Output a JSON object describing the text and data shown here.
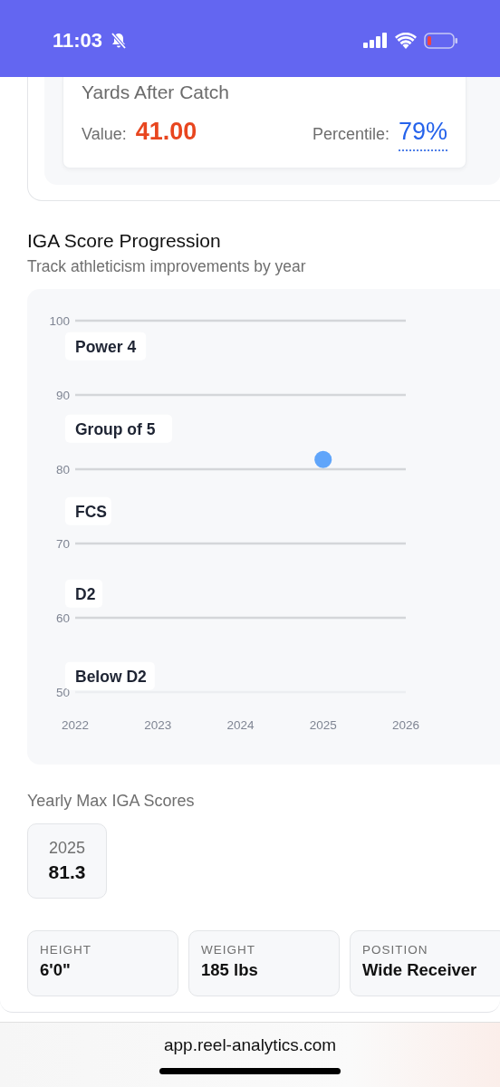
{
  "status_bar": {
    "time": "11:03"
  },
  "metric": {
    "title": "Yards After Catch",
    "value_label": "Value:",
    "value": "41.00",
    "percentile_label": "Percentile:",
    "percentile": "79%"
  },
  "progression": {
    "title": "IGA Score Progression",
    "subtitle": "Track athleticism improvements by year",
    "chart_data": {
      "type": "scatter",
      "x": [
        2025
      ],
      "series": [
        {
          "color": "#60a5fa",
          "values": [
            81.3
          ]
        }
      ],
      "xlim": [
        2022,
        2026
      ],
      "ylim": [
        50,
        100
      ],
      "xticks": [
        2022,
        2023,
        2024,
        2025,
        2026
      ],
      "yticks": [
        50,
        60,
        70,
        80,
        90,
        100
      ],
      "grid": true,
      "annotations": [
        "Power 4",
        "Group of 5",
        "FCS",
        "D2",
        "Below D2"
      ]
    }
  },
  "yearly": {
    "title": "Yearly Max IGA Scores",
    "items": [
      {
        "year": "2025",
        "score": "81.3"
      }
    ]
  },
  "info": [
    {
      "label": "HEIGHT",
      "value": "6'0\""
    },
    {
      "label": "WEIGHT",
      "value": "185 lbs"
    },
    {
      "label": "POSITION",
      "value": "Wide Receiver"
    }
  ],
  "browser": {
    "url": "app.reel-analytics.com"
  }
}
